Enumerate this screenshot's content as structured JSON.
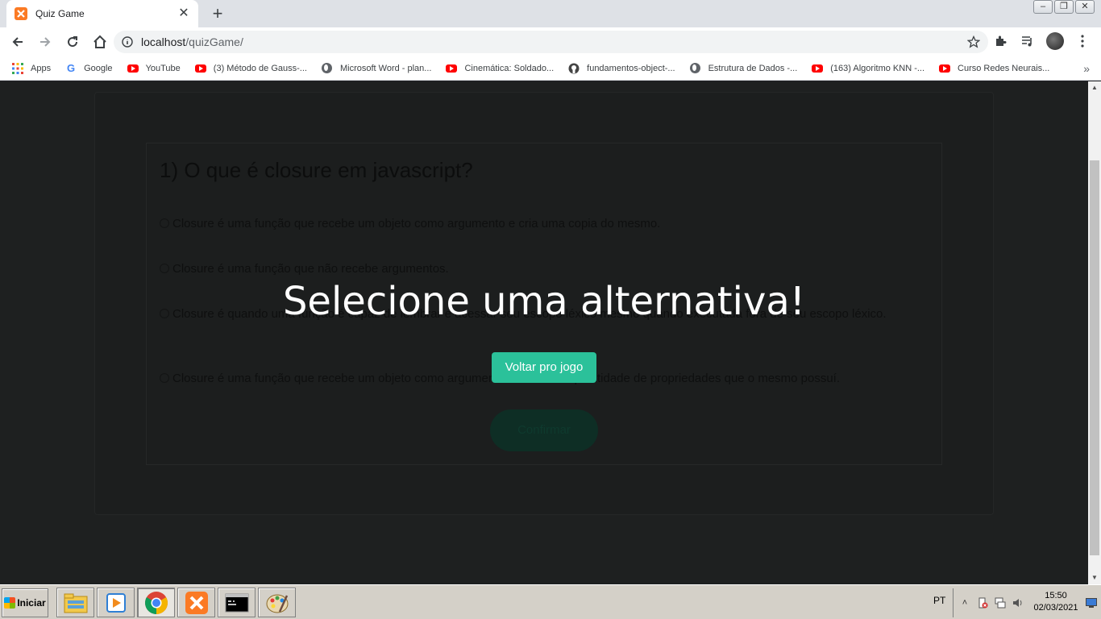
{
  "browser": {
    "tab_title": "Quiz Game",
    "url_host": "localhost",
    "url_path": "/quizGame/",
    "bookmarks": [
      {
        "label": "Apps",
        "icon": "apps-grid-icon"
      },
      {
        "label": "Google",
        "icon": "google-icon"
      },
      {
        "label": "YouTube",
        "icon": "youtube-icon"
      },
      {
        "label": "(3) Método de Gauss-...",
        "icon": "youtube-icon"
      },
      {
        "label": "Microsoft Word - plan...",
        "icon": "globe-icon"
      },
      {
        "label": "Cinemática: Soldado...",
        "icon": "youtube-icon"
      },
      {
        "label": "fundamentos-object-...",
        "icon": "github-icon"
      },
      {
        "label": "Estrutura de Dados -...",
        "icon": "globe-icon"
      },
      {
        "label": "(163) Algoritmo KNN -...",
        "icon": "youtube-icon"
      },
      {
        "label": "Curso Redes Neurais...",
        "icon": "youtube-icon"
      }
    ]
  },
  "quiz": {
    "question": "1) O que é closure em javascript?",
    "options": [
      "Closure é uma função que recebe um objeto como argumento e cria uma copia do mesmo.",
      "Closure é uma função que não recebe argumentos.",
      "Closure é quando uma função é capaz de lembrar e acessar seu escopo léxico mesmo quando executada fora de seu escopo léxico.",
      "Closure é uma função que recebe um objeto como argumento e retorna a quantidade de propriedades que o mesmo possuí."
    ],
    "confirm_label": "Confirmar"
  },
  "modal": {
    "title": "Selecione uma alternativa!",
    "button_label": "Voltar pro jogo"
  },
  "taskbar": {
    "start_label": "Iniciar",
    "language": "PT",
    "time": "15:50",
    "date": "02/03/2021"
  },
  "colors": {
    "accent": "#2bc19a",
    "page_bg": "#1e2020"
  }
}
